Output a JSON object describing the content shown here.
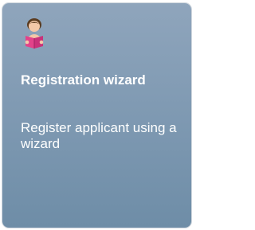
{
  "tile": {
    "icon": "person-reading-book-icon",
    "title": "Registration wizard",
    "description": "Register applicant using a wizard"
  },
  "colors": {
    "tile_background_top": "#8fa5bc",
    "tile_background_bottom": "#6e8da7",
    "text": "#ffffff",
    "icon_skin": "#f3c8a8",
    "icon_hair": "#5a3b1f",
    "icon_book": "#e2438a"
  }
}
